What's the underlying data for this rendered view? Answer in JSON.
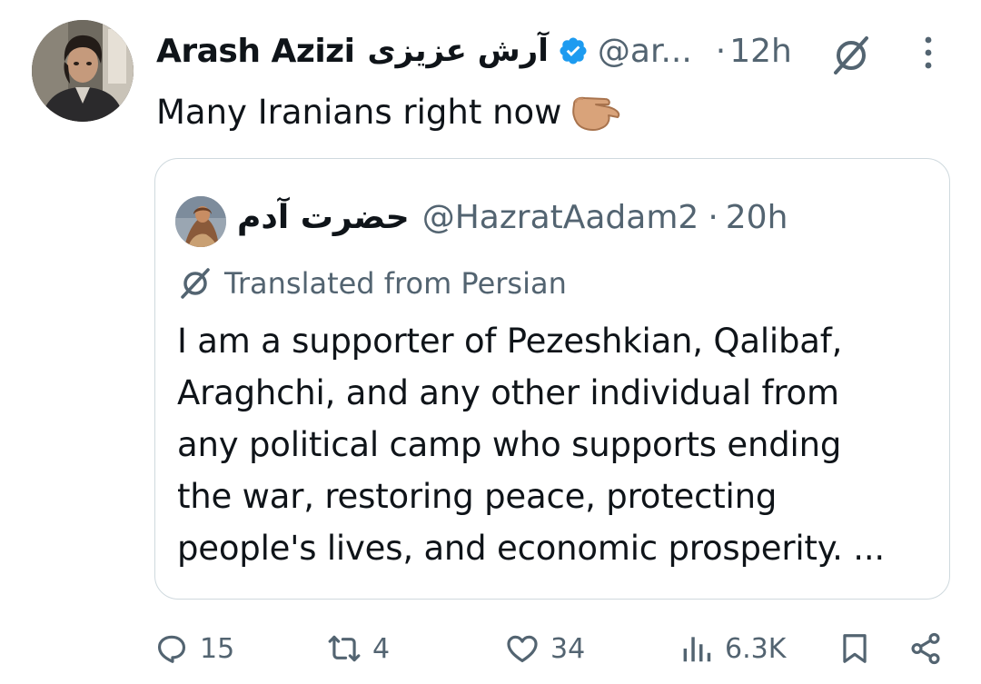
{
  "tweet": {
    "author_name": "Arash Azizi",
    "author_name_fa": "آرش عزیزی",
    "handle": "@ar...",
    "separator": "·",
    "time": "12h",
    "text": "Many Iranians right now"
  },
  "quote": {
    "author_name": "حضرت آدم",
    "handle": "@HazratAadam2",
    "separator": "·",
    "time": "20h",
    "translated_label": "Translated from Persian",
    "lines": [
      "I am a supporter of Pezeshkian, Qalibaf,",
      "Araghchi, and any other individual from",
      "any political camp who supports ending",
      "the war, restoring peace, protecting",
      "people's lives, and economic prosperity. ..."
    ]
  },
  "actions": {
    "replies": "15",
    "reposts": "4",
    "likes": "34",
    "views": "6.3K"
  },
  "colors": {
    "verified": "#1d9bf0",
    "secondary_text": "#536471",
    "border": "#cfd9de"
  },
  "icons": [
    "verified-badge-icon",
    "translate-icon",
    "more-icon",
    "backhand-index-pointing-down-emoji",
    "reply-icon",
    "repost-icon",
    "like-icon",
    "views-icon",
    "bookmark-icon",
    "share-icon"
  ]
}
